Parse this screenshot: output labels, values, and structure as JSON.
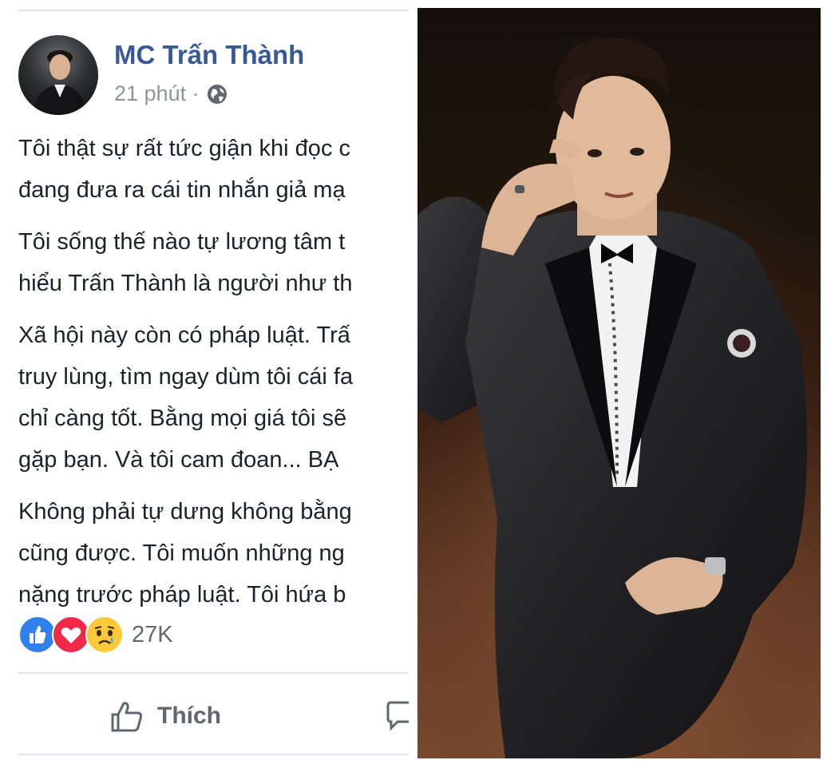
{
  "post": {
    "author": "MC Trấn Thành",
    "time": "21 phút ·",
    "paragraphs": [
      [
        "Tôi thật sự rất tức giận khi đọc c",
        "đang đưa ra cái tin nhắn giả mạ"
      ],
      [
        "Tôi sống thế nào tự lương tâm t",
        "hiểu Trấn Thành là người như th"
      ],
      [
        "Xã hội này còn có pháp luật. Trấ",
        "truy lùng, tìm ngay dùm tôi cái fa",
        "chỉ càng tốt. Bằng mọi giá tôi sẽ",
        "gặp bạn. Và tôi cam đoan... BẠ"
      ],
      [
        "Không phải tự dưng không bằng",
        "cũng được. Tôi muốn những ng",
        "nặng trước pháp luật. Tôi hứa b"
      ]
    ],
    "reaction_count": "27K",
    "reactions": [
      "like-icon",
      "love-icon",
      "sad-icon"
    ],
    "like_label": "Thích"
  },
  "colors": {
    "author": "#385898",
    "muted": "#90949c",
    "text": "#1d2129",
    "like": "#2f80ed",
    "love": "#f0284a",
    "sad": "#fcc937"
  }
}
